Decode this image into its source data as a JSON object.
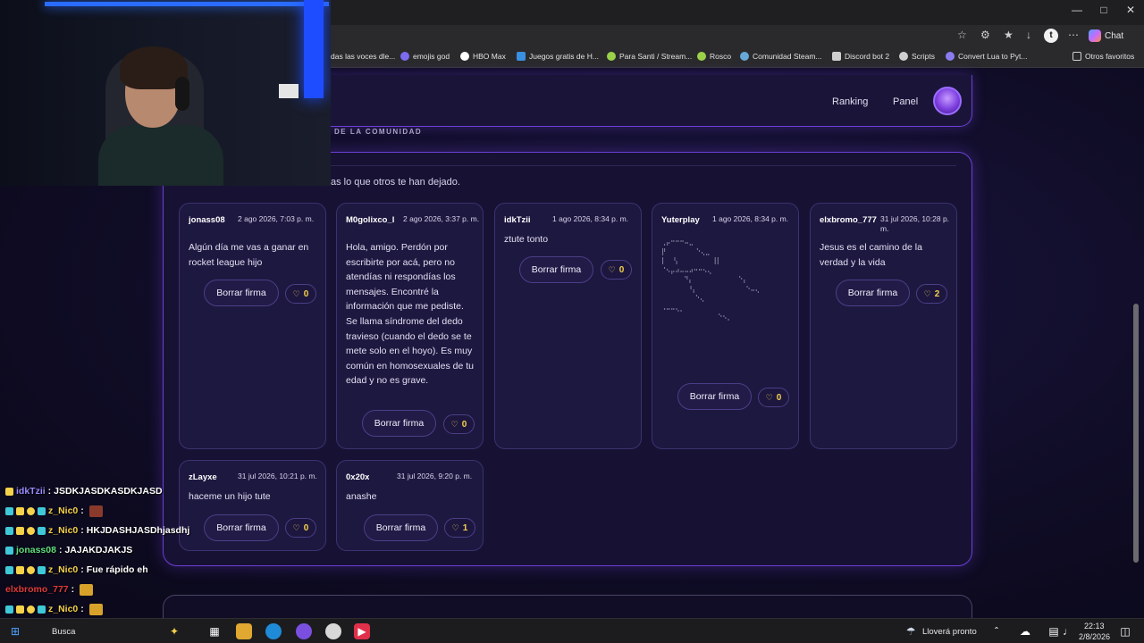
{
  "browser": {
    "bookmarks": [
      {
        "label": "das las voces dle...",
        "color": "#8a8a8a"
      },
      {
        "label": "emojis god",
        "color": "#7b6cf0"
      },
      {
        "label": "HBO Max",
        "color": "#ffffff"
      },
      {
        "label": "Juegos gratis de H...",
        "color": "#3a8fe0"
      },
      {
        "label": "Para Santi / Stream...",
        "color": "#9bd14a"
      },
      {
        "label": "Rosco",
        "color": "#9bd14a"
      },
      {
        "label": "Comunidad Steam...",
        "color": "#66a8d8"
      },
      {
        "label": "Discord bot 2",
        "color": "#cfcfcf"
      },
      {
        "label": "Scripts",
        "color": "#cfcfcf"
      },
      {
        "label": "Convert Lua to Pyt...",
        "color": "#8a7cf0"
      }
    ],
    "other_favorites": "Otros favoritos",
    "chat_label": "Chat",
    "profile_initial": "t"
  },
  "nav": {
    "ranking": "Ranking",
    "panel": "Panel"
  },
  "section_label": "DE LA COMUNIDAD",
  "subtitle": "as lo que otros te han dejado.",
  "signatures": [
    {
      "user": "jonass08",
      "date": "2 ago 2026, 7:03 p. m.",
      "message": "Algún día me vas a ganar en rocket league hijo",
      "button": "Borrar firma",
      "likes": "0"
    },
    {
      "user": "M0golixco_l",
      "date": "2 ago 2026, 3:37 p. m.",
      "message": "Hola, amigo. Perdón por escribirte por acá, pero no atendías ni respondías los mensajes. Encontré la información que me pediste. Se llama síndrome del dedo travieso (cuando el dedo se te mete solo en el hoyo). Es muy común en homosexuales de tu edad y no es grave.",
      "button": "Borrar firma",
      "likes": "0"
    },
    {
      "user": "idkTzii",
      "date": "1 ago 2026, 8:34 p. m.",
      "message": "ztute tonto",
      "button": "Borrar firma",
      "likes": "0"
    },
    {
      "user": "Yuterplay",
      "date": "1 ago 2026, 8:34 p. m.",
      "message": "",
      "button": "Borrar firma",
      "likes": "0"
    },
    {
      "user": "elxbromo_777",
      "date": "31 jul 2026, 10:28 p. m.",
      "message": "Jesus es el camino de la verdad y la vida",
      "button": "Borrar firma",
      "likes": "2"
    },
    {
      "user": "zLayxe",
      "date": "31 jul 2026, 10:21 p. m.",
      "message": "haceme un hijo tute",
      "button": "Borrar firma",
      "likes": "0"
    },
    {
      "user": "0x20x",
      "date": "31 jul 2026, 9:20 p. m.",
      "message": "anashe",
      "button": "Borrar firma",
      "likes": "1"
    }
  ],
  "chat": [
    {
      "user": "idkTzii",
      "user_color": "#9a8cff",
      "sep": " : ",
      "text": "JSDKJASDKASDKJASD"
    },
    {
      "user": "z_Nic0",
      "user_color": "#f5d24a",
      "sep": " : ",
      "text": ""
    },
    {
      "user": "z_Nic0",
      "user_color": "#f5d24a",
      "sep": " : ",
      "text": "HKJDASHJASDhjasdhj"
    },
    {
      "user": "jonass08",
      "user_color": "#5fe07a",
      "sep": " : ",
      "text": "JAJAKDJAKJS"
    },
    {
      "user": "z_Nic0",
      "user_color": "#f5d24a",
      "sep": " : ",
      "text": "Fue rápido eh"
    },
    {
      "user": "elxbromo_777",
      "user_color": "#e03a3a",
      "sep": " : ",
      "text": ""
    },
    {
      "user": "z_Nic0",
      "user_color": "#f5d24a",
      "sep": " : ",
      "text": ""
    },
    {
      "user": "jonass08",
      "user_color": "#5fe07a",
      "sep": " : ",
      "text": ""
    }
  ],
  "taskbar": {
    "search": "Busca",
    "weather": "Lloverá pronto",
    "time": "22:13",
    "date": "2/8/2026"
  },
  "colors": {
    "accent": "#6b3fd6",
    "like": "#f5d24a",
    "card": "#1d1840"
  }
}
